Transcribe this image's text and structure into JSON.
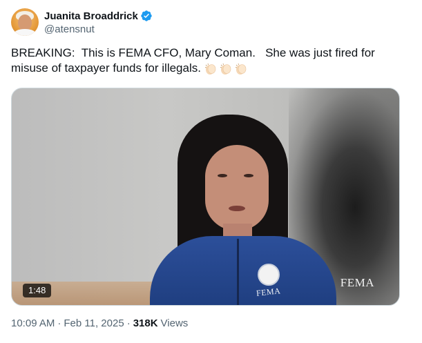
{
  "author": {
    "display_name": "Juanita Broaddrick",
    "handle": "@atensnut",
    "verified_icon": "verified-badge-icon",
    "verified_color": "#1d9bf0"
  },
  "tweet": {
    "text": "BREAKING:  This is FEMA CFO, Mary Coman.   She was just fired for misuse of taxpayer funds for illegals.",
    "emoji": [
      "clapping-hands-icon",
      "clapping-hands-icon",
      "clapping-hands-icon"
    ]
  },
  "media": {
    "type": "video",
    "duration": "1:48",
    "watermark": "FEMA",
    "jacket_text": "FEMA"
  },
  "meta": {
    "time": "10:09 AM",
    "date": "Feb 11, 2025",
    "views_count": "318K",
    "views_label": "Views",
    "separator": "·"
  }
}
